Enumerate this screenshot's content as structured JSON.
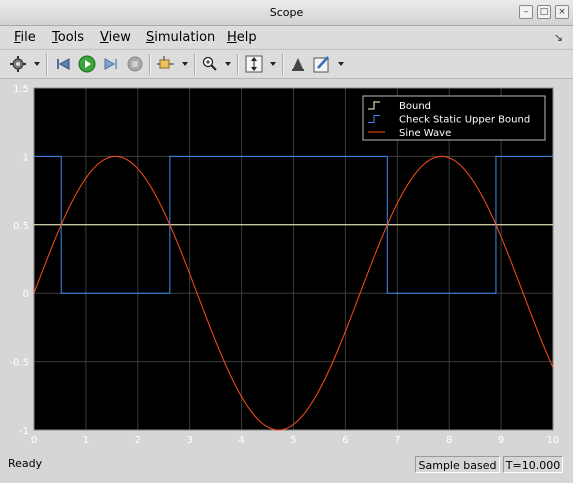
{
  "window": {
    "title": "Scope"
  },
  "menu": [
    {
      "label": "File",
      "mnemonic": "F",
      "rest": "ile"
    },
    {
      "label": "Tools",
      "mnemonic": "T",
      "rest": "ools"
    },
    {
      "label": "View",
      "mnemonic": "V",
      "rest": "iew"
    },
    {
      "label": "Simulation",
      "mnemonic": "S",
      "rest": "imulation"
    },
    {
      "label": "Help",
      "mnemonic": "H",
      "rest": "elp"
    }
  ],
  "toolbar": {
    "icons": [
      "gear-icon",
      "step-back-icon",
      "run-icon",
      "step-forward-icon",
      "stop-icon",
      "signal-selector-icon",
      "zoom-in-icon",
      "scale-axes-icon",
      "highlight-icon",
      "edit-style-icon"
    ]
  },
  "colors": {
    "plot_bg": "#000000",
    "grid": "#3c3c3c",
    "axis_text": "#ffffff",
    "bound": "#ffffcc",
    "check": "#3d8cf0",
    "sine": "#ff4d1a"
  },
  "status": {
    "ready": "Ready",
    "sample_mode": "Sample based",
    "time": "T=10.000"
  },
  "chart_data": {
    "type": "line",
    "xlim": [
      0,
      10
    ],
    "ylim": [
      -1,
      1.5
    ],
    "x_ticks": [
      "0",
      "1",
      "2",
      "3",
      "4",
      "5",
      "6",
      "7",
      "8",
      "9",
      "10"
    ],
    "y_ticks": [
      "-1",
      "-0.5",
      "0",
      "0.5",
      "1",
      "1.5"
    ],
    "grid": true,
    "legend_position": "top-right",
    "series": [
      {
        "name": "Bound",
        "style": "step",
        "x": [
          0,
          10
        ],
        "y": [
          0.5,
          0.5
        ]
      },
      {
        "name": "Check Static  Upper Bound",
        "style": "step",
        "x": [
          0,
          0.524,
          0.524,
          2.618,
          2.618,
          6.807,
          6.807,
          8.901,
          8.901,
          10
        ],
        "y": [
          1,
          1,
          0,
          0,
          1,
          1,
          0,
          0,
          1,
          1
        ]
      },
      {
        "name": "Sine Wave",
        "style": "sine",
        "amplitude": 1,
        "frequency_rad_per_s": 1,
        "x_range": [
          0,
          10
        ]
      }
    ]
  }
}
